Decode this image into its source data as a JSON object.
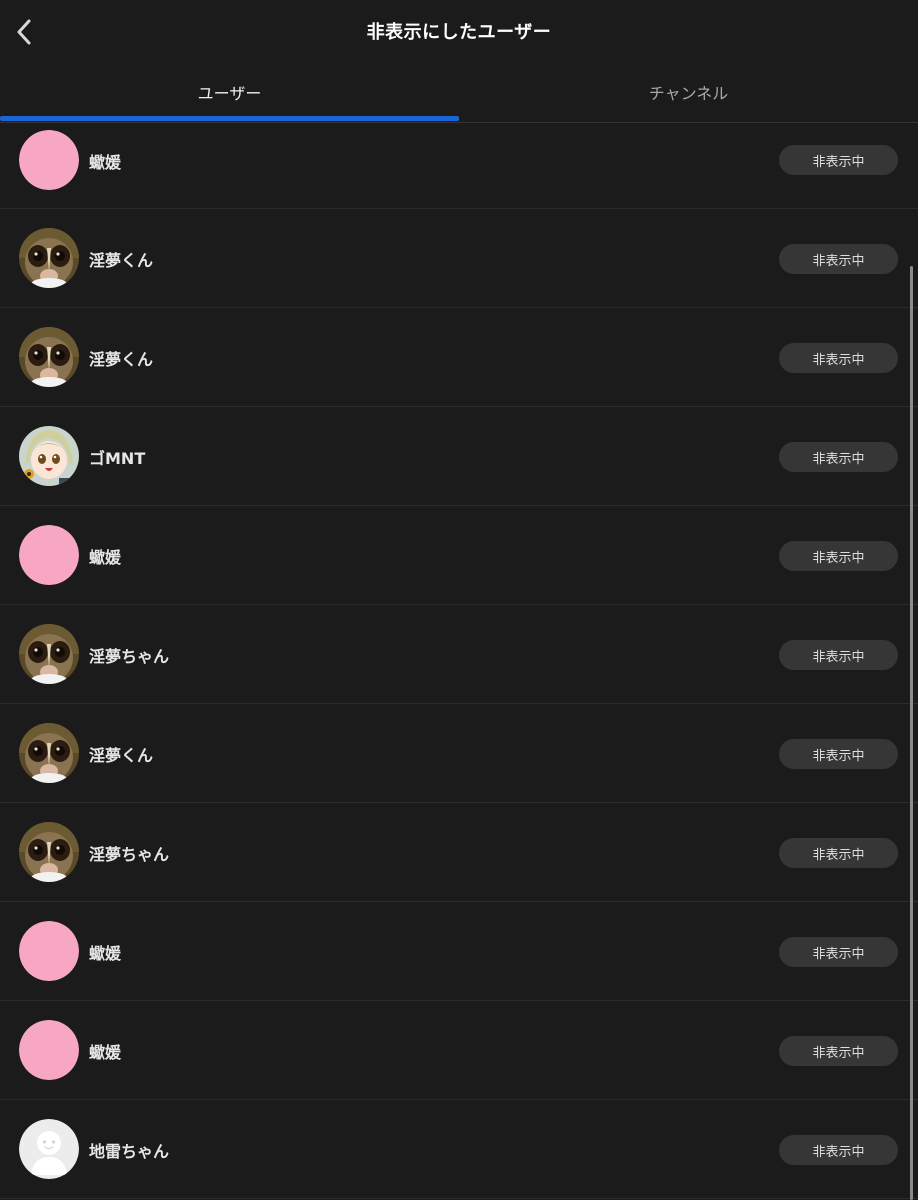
{
  "header": {
    "title": "非表示にしたユーザー"
  },
  "tabs": [
    {
      "label": "ユーザー",
      "active": true
    },
    {
      "label": "チャンネル",
      "active": false
    }
  ],
  "colors": {
    "accent": "#1a66d6",
    "background": "#1b1b1b",
    "button_bg": "#363636",
    "pink_avatar": "#f7a7c4"
  },
  "users": [
    {
      "name": "蠍媛",
      "avatar": "pink-circle",
      "button": "非表示中"
    },
    {
      "name": "淫夢くん",
      "avatar": "slow-loris-photo",
      "button": "非表示中"
    },
    {
      "name": "淫夢くん",
      "avatar": "slow-loris-photo",
      "button": "非表示中"
    },
    {
      "name": "ゴMNT",
      "avatar": "anime-character",
      "button": "非表示中"
    },
    {
      "name": "蠍媛",
      "avatar": "pink-circle",
      "button": "非表示中"
    },
    {
      "name": "淫夢ちゃん",
      "avatar": "slow-loris-photo",
      "button": "非表示中"
    },
    {
      "name": "淫夢くん",
      "avatar": "slow-loris-photo",
      "button": "非表示中"
    },
    {
      "name": "淫夢ちゃん",
      "avatar": "slow-loris-photo",
      "button": "非表示中"
    },
    {
      "name": "蠍媛",
      "avatar": "pink-circle",
      "button": "非表示中"
    },
    {
      "name": "蠍媛",
      "avatar": "pink-circle",
      "button": "非表示中"
    },
    {
      "name": "地雷ちゃん",
      "avatar": "default-person",
      "button": "非表示中"
    }
  ]
}
